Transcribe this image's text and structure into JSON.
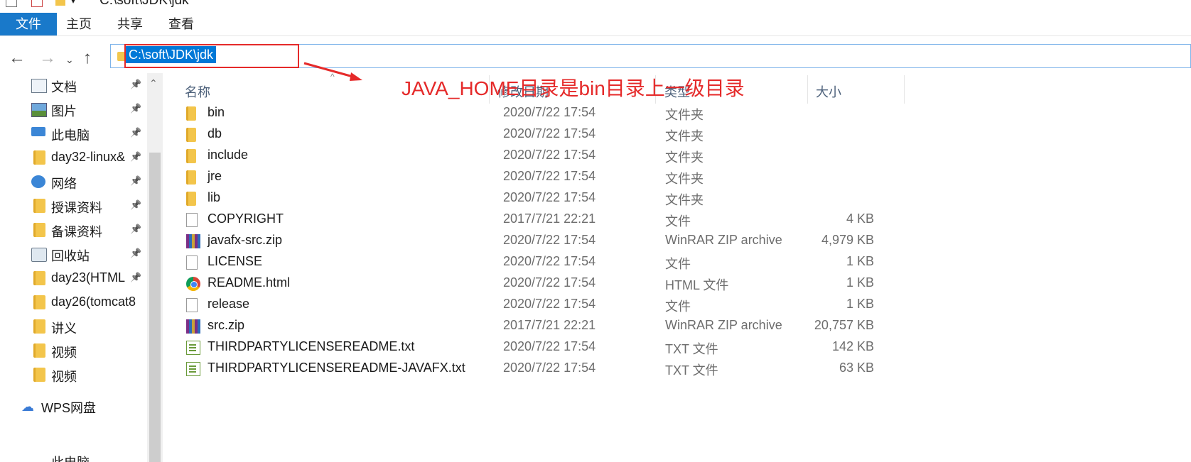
{
  "window": {
    "title": "C:\\soft\\JDK\\jdk"
  },
  "ribbon": {
    "tabs": [
      "文件",
      "主页",
      "共享",
      "查看"
    ]
  },
  "address": {
    "path": "C:\\soft\\JDK\\jdk"
  },
  "annotation": {
    "text": "JAVA_HOME目录是bin目录上一级目录",
    "color": "#e52a2a"
  },
  "nav_pane": {
    "items": [
      {
        "label": "文档",
        "icon": "document-icon",
        "pinned": true
      },
      {
        "label": "图片",
        "icon": "picture-icon",
        "pinned": true
      },
      {
        "label": "此电脑",
        "icon": "computer-icon",
        "pinned": true
      },
      {
        "label": "day32-linux&",
        "icon": "folder-icon",
        "pinned": true
      },
      {
        "label": "网络",
        "icon": "network-icon",
        "pinned": true
      },
      {
        "label": "授课资料",
        "icon": "folder-icon",
        "pinned": true
      },
      {
        "label": "备课资料",
        "icon": "folder-icon",
        "pinned": true
      },
      {
        "label": "回收站",
        "icon": "recycle-bin-icon",
        "pinned": true
      },
      {
        "label": "day23(HTML",
        "icon": "folder-icon",
        "pinned": true
      },
      {
        "label": "day26(tomcat8",
        "icon": "folder-icon",
        "pinned": false
      },
      {
        "label": "讲义",
        "icon": "folder-icon",
        "pinned": false
      },
      {
        "label": "视频",
        "icon": "folder-icon",
        "pinned": false
      },
      {
        "label": "视频",
        "icon": "folder-icon",
        "pinned": false
      }
    ],
    "wps": "WPS网盘",
    "bottom_partial": "此电脑"
  },
  "columns": {
    "name": "名称",
    "date": "修改日期",
    "type": "类型",
    "size": "大小"
  },
  "files": [
    {
      "name": "bin",
      "date": "2020/7/22 17:54",
      "type": "文件夹",
      "size": "",
      "icon": "folder-icon"
    },
    {
      "name": "db",
      "date": "2020/7/22 17:54",
      "type": "文件夹",
      "size": "",
      "icon": "folder-icon"
    },
    {
      "name": "include",
      "date": "2020/7/22 17:54",
      "type": "文件夹",
      "size": "",
      "icon": "folder-icon"
    },
    {
      "name": "jre",
      "date": "2020/7/22 17:54",
      "type": "文件夹",
      "size": "",
      "icon": "folder-icon"
    },
    {
      "name": "lib",
      "date": "2020/7/22 17:54",
      "type": "文件夹",
      "size": "",
      "icon": "folder-icon"
    },
    {
      "name": "COPYRIGHT",
      "date": "2017/7/21 22:21",
      "type": "文件",
      "size": "4 KB",
      "icon": "file-icon"
    },
    {
      "name": "javafx-src.zip",
      "date": "2020/7/22 17:54",
      "type": "WinRAR ZIP archive",
      "size": "4,979 KB",
      "icon": "zip-icon"
    },
    {
      "name": "LICENSE",
      "date": "2020/7/22 17:54",
      "type": "文件",
      "size": "1 KB",
      "icon": "file-icon"
    },
    {
      "name": "README.html",
      "date": "2020/7/22 17:54",
      "type": "HTML 文件",
      "size": "1 KB",
      "icon": "html-icon"
    },
    {
      "name": "release",
      "date": "2020/7/22 17:54",
      "type": "文件",
      "size": "1 KB",
      "icon": "file-icon"
    },
    {
      "name": "src.zip",
      "date": "2017/7/21 22:21",
      "type": "WinRAR ZIP archive",
      "size": "20,757 KB",
      "icon": "zip-icon"
    },
    {
      "name": "THIRDPARTYLICENSEREADME.txt",
      "date": "2020/7/22 17:54",
      "type": "TXT 文件",
      "size": "142 KB",
      "icon": "txt-icon"
    },
    {
      "name": "THIRDPARTYLICENSEREADME-JAVAFX.txt",
      "date": "2020/7/22 17:54",
      "type": "TXT 文件",
      "size": "63 KB",
      "icon": "txt-icon"
    }
  ]
}
